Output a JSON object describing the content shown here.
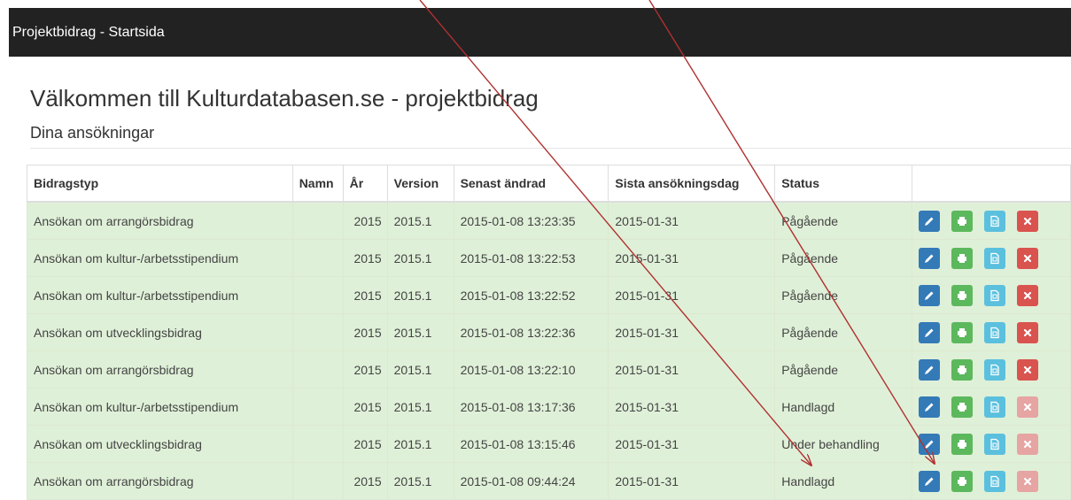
{
  "navbar": {
    "brand": "Projektbidrag - Startsida"
  },
  "header": {
    "title": "Välkommen till Kulturdatabasen.se - projektbidrag",
    "subtitle": "Dina ansökningar"
  },
  "table": {
    "columns": [
      "Bidragstyp",
      "Namn",
      "År",
      "Version",
      "Senast ändrad",
      "Sista ansökningsdag",
      "Status",
      ""
    ],
    "rows": [
      {
        "type": "Ansökan om arrangörsbidrag",
        "name": "",
        "year": "2015",
        "version": "2015.1",
        "modified": "2015-01-08 13:23:35",
        "deadline": "2015-01-31",
        "status": "Pågående",
        "delete_enabled": true
      },
      {
        "type": "Ansökan om kultur-/arbetsstipendium",
        "name": "",
        "year": "2015",
        "version": "2015.1",
        "modified": "2015-01-08 13:22:53",
        "deadline": "2015-01-31",
        "status": "Pågående",
        "delete_enabled": true
      },
      {
        "type": "Ansökan om kultur-/arbetsstipendium",
        "name": "",
        "year": "2015",
        "version": "2015.1",
        "modified": "2015-01-08 13:22:52",
        "deadline": "2015-01-31",
        "status": "Pågående",
        "delete_enabled": true
      },
      {
        "type": "Ansökan om utvecklingsbidrag",
        "name": "",
        "year": "2015",
        "version": "2015.1",
        "modified": "2015-01-08 13:22:36",
        "deadline": "2015-01-31",
        "status": "Pågående",
        "delete_enabled": true
      },
      {
        "type": "Ansökan om arrangörsbidrag",
        "name": "",
        "year": "2015",
        "version": "2015.1",
        "modified": "2015-01-08 13:22:10",
        "deadline": "2015-01-31",
        "status": "Pågående",
        "delete_enabled": true
      },
      {
        "type": "Ansökan om kultur-/arbetsstipendium",
        "name": "",
        "year": "2015",
        "version": "2015.1",
        "modified": "2015-01-08 13:17:36",
        "deadline": "2015-01-31",
        "status": "Handlagd",
        "delete_enabled": false
      },
      {
        "type": "Ansökan om utvecklingsbidrag",
        "name": "",
        "year": "2015",
        "version": "2015.1",
        "modified": "2015-01-08 13:15:46",
        "deadline": "2015-01-31",
        "status": "Under behandling",
        "delete_enabled": false
      },
      {
        "type": "Ansökan om arrangörsbidrag",
        "name": "",
        "year": "2015",
        "version": "2015.1",
        "modified": "2015-01-08 09:44:24",
        "deadline": "2015-01-31",
        "status": "Handlagd",
        "delete_enabled": false
      }
    ]
  },
  "icons": {
    "edit": "pencil-icon",
    "print": "print-icon",
    "document": "document-icon",
    "delete": "close-icon"
  },
  "colors": {
    "navbar": "#222222",
    "row_background": "#dff0d8",
    "edit_button": "#337ab7",
    "print_button": "#5cb85c",
    "document_button": "#5bc0de",
    "delete_button": "#d9534f",
    "annotation_arrow": "#b03030"
  }
}
